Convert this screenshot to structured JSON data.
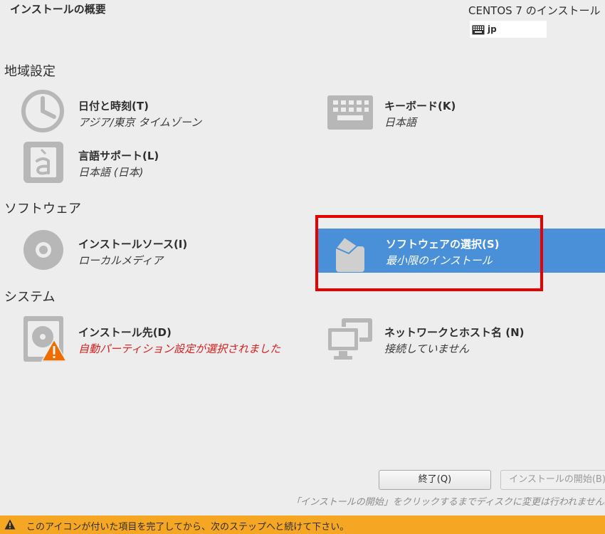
{
  "header": {
    "title": "インストールの概要",
    "product": "CENTOS 7 のインストール",
    "keyboard_layout": "jp"
  },
  "sections": {
    "localization": "地域設定",
    "software": "ソフトウェア",
    "system": "システム"
  },
  "spokes": {
    "datetime": {
      "title": "日付と時刻(T)",
      "status": "アジア/東京 タイムゾーン",
      "icon": "clock-icon"
    },
    "keyboard": {
      "title": "キーボード(K)",
      "status": "日本語",
      "icon": "keyboard-icon"
    },
    "language": {
      "title": "言語サポート(L)",
      "status": "日本語 (日本)",
      "icon": "language-icon"
    },
    "source": {
      "title": "インストールソース(I)",
      "status": "ローカルメディア",
      "icon": "disc-icon"
    },
    "software": {
      "title": "ソフトウェアの選択(S)",
      "status": "最小限のインストール",
      "icon": "package-icon"
    },
    "destination": {
      "title": "インストール先(D)",
      "status": "自動パーティション設定が選択されました",
      "icon": "harddisk-warning-icon"
    },
    "network": {
      "title": "ネットワークとホスト名 (N)",
      "status": "接続していません",
      "icon": "network-icon"
    }
  },
  "buttons": {
    "quit": "終了(Q)",
    "begin": "インストールの開始(B)"
  },
  "hint": "「インストールの開始」をクリックするまでディスクに変更は行われません。",
  "warning_bar": {
    "text": "このアイコンが付いた項目を完了してから、次のステップへと続けて下さい。",
    "icon": "warning-icon"
  },
  "colors": {
    "selected": "#4a90d9",
    "highlight_border": "#e60000",
    "warning": "#f5a623",
    "error_text": "#d51f1f"
  }
}
